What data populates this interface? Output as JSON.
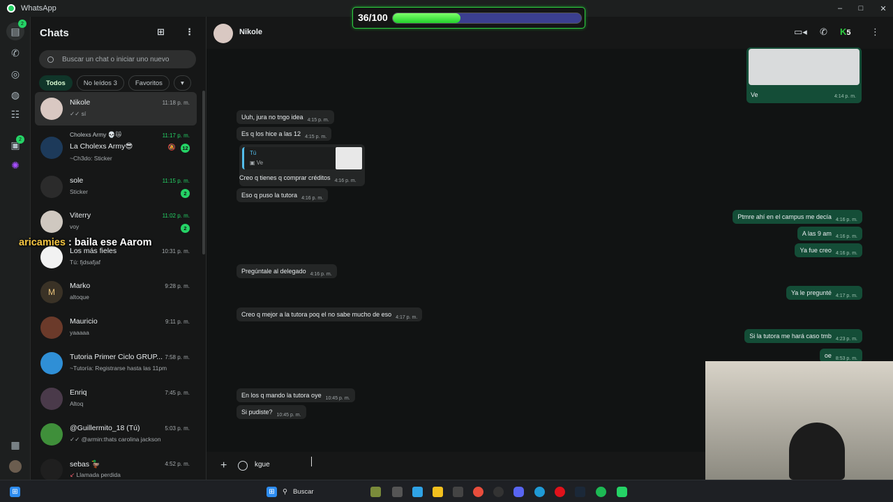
{
  "app": {
    "title": "WhatsApp"
  },
  "window": {
    "minimize": "–",
    "maximize": "□",
    "close": "✕"
  },
  "progress": {
    "label": "36/100",
    "value": 36,
    "max": 100
  },
  "sidebar": {
    "title": "Chats",
    "search_placeholder": "Buscar un chat o iniciar uno nuevo",
    "filters": [
      "Todos",
      "No leídos 3",
      "Favoritos"
    ],
    "chats": [
      {
        "name": "Nikole",
        "preview": "sí",
        "time": "11:18 p. m.",
        "badge": ""
      },
      {
        "name": "La Cholexs Army😎",
        "pre_name": "Cholexs Army 💀😿",
        "preview": "~Ch3do: Sticker",
        "time": "11:17 p. m.",
        "badge": "12"
      },
      {
        "name": "sole",
        "preview": "Sticker",
        "time": "11:15 p. m.",
        "badge": "2"
      },
      {
        "name": "Viterry",
        "preview": "voy",
        "time": "11:02 p. m.",
        "badge": "2"
      },
      {
        "name": "Los más fieles",
        "preview": "Tú: fjdsafjaf",
        "time": "10:31 p. m.",
        "badge": ""
      },
      {
        "name": "Marko",
        "preview": "altoque",
        "time": "9:28 p. m.",
        "badge": ""
      },
      {
        "name": "Mauricio",
        "preview": "yaaaaa",
        "time": "9:11 p. m.",
        "badge": ""
      },
      {
        "name": "Tutoria Primer Ciclo GRUP...",
        "preview": "~Tutoría: Registrarse hasta las 11pm",
        "time": "7:58 p. m.",
        "badge": ""
      },
      {
        "name": "Enriq",
        "preview": "Altoq",
        "time": "7:45 p. m.",
        "badge": ""
      },
      {
        "name": "@Guillermito_18 (Tú)",
        "preview": "@armin:thats carolina jackson",
        "time": "5:03 p. m.",
        "badge": ""
      },
      {
        "name": "sebas 🦆",
        "preview": "Llamada perdida",
        "time": "4:52 p. m.",
        "badge": ""
      }
    ]
  },
  "stream_overlay": {
    "user": "aricamies",
    "text": " : baila ese Aarom"
  },
  "conversation": {
    "contact": "Nikole",
    "messages_in": [
      {
        "text": "Uuh, jura no tngo idea",
        "time": "4:15 p. m."
      },
      {
        "text": "Es q los hice a las 12",
        "time": "4:15 p. m."
      },
      {
        "text": "Creo q tienes q comprar créditos",
        "time": "4:16 p. m."
      },
      {
        "text": "Eso q puso la tutora",
        "time": "4:16 p. m."
      },
      {
        "text": "Pregúntale al delegado",
        "time": "4:16 p. m."
      },
      {
        "text": "Creo q mejor a la tutora poq el no sabe mucho de eso",
        "time": "4:17 p. m."
      },
      {
        "text": "En los q mando la tutora oye",
        "time": "10:45 p. m."
      },
      {
        "text": "Si pudiste?",
        "time": "10:45 p. m."
      }
    ],
    "reply_quote": {
      "author": "Tú",
      "text": "Ve"
    },
    "messages_out": [
      {
        "text": "Ve",
        "time": "4:14 p. m."
      },
      {
        "text": "Ptmre ahí en el campus me decía",
        "time": "4:16 p. m."
      },
      {
        "text": "A las 9 am",
        "time": "4:16 p. m."
      },
      {
        "text": "Ya fue creo",
        "time": "4:16 p. m."
      },
      {
        "text": "Ya le pregunté",
        "time": "4:17 p. m."
      },
      {
        "text": "Si la tutora me hará caso tmb",
        "time": "4:23 p. m."
      },
      {
        "text": "oe",
        "time": "8:53 p. m."
      }
    ],
    "composer_value": "kgue"
  },
  "header_right": {
    "badge": "5"
  },
  "taskbar": {
    "search": "Buscar"
  },
  "colors": {
    "accent": "#25d366",
    "out_bubble": "#144d37",
    "in_bubble": "#242626",
    "progress_fill": "#22d12c"
  }
}
